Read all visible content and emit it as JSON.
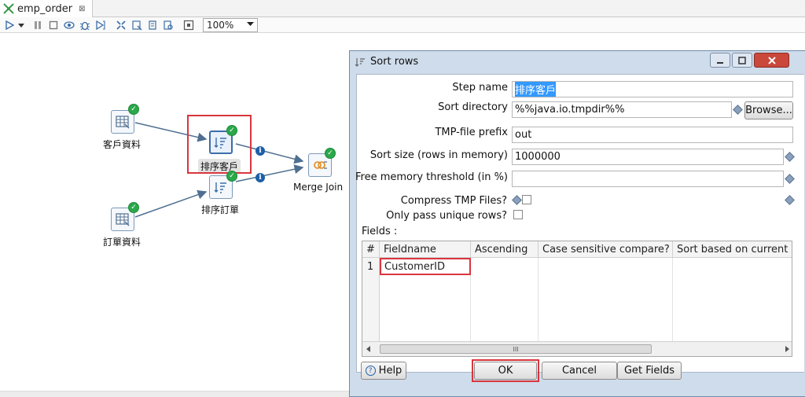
{
  "tab": {
    "title": "emp_order",
    "close": "⊠"
  },
  "toolbar": {
    "zoom": "100%"
  },
  "canvas": {
    "nodes": {
      "customer_data": "客戶資料",
      "sort_customer": "排序客戶",
      "sort_order": "排序訂單",
      "order_data": "訂單資料",
      "merge_join": "Merge Join"
    },
    "info_glyph": "i"
  },
  "dialog": {
    "title": "Sort rows",
    "step_name_label": "Step name",
    "step_name_value": "排序客戶",
    "sort_dir_label": "Sort directory",
    "sort_dir_value": "%%java.io.tmpdir%%",
    "browse_label": "Browse...",
    "tmp_prefix_label": "TMP-file prefix",
    "tmp_prefix_value": "out",
    "sort_size_label": "Sort size (rows in memory)",
    "sort_size_value": "1000000",
    "free_mem_label": "Free memory threshold (in %)",
    "free_mem_value": "",
    "compress_label": "Compress TMP Files?",
    "unique_label": "Only pass unique rows?",
    "fields_label": "Fields :",
    "table": {
      "headers": [
        "#",
        "Fieldname",
        "Ascending",
        "Case sensitive compare?",
        "Sort based on current loc"
      ],
      "rows": [
        {
          "num": "1",
          "fieldname": "CustomerID",
          "ascending": "",
          "case": "",
          "locale": ""
        }
      ],
      "scroll_grip": "III"
    },
    "help_label": "Help",
    "help_glyph": "?",
    "ok_label": "OK",
    "cancel_label": "Cancel",
    "get_fields_label": "Get Fields"
  },
  "colors": {
    "highlight": "#d9363e",
    "check": "#2aa84a",
    "info": "#1d5fa8"
  }
}
